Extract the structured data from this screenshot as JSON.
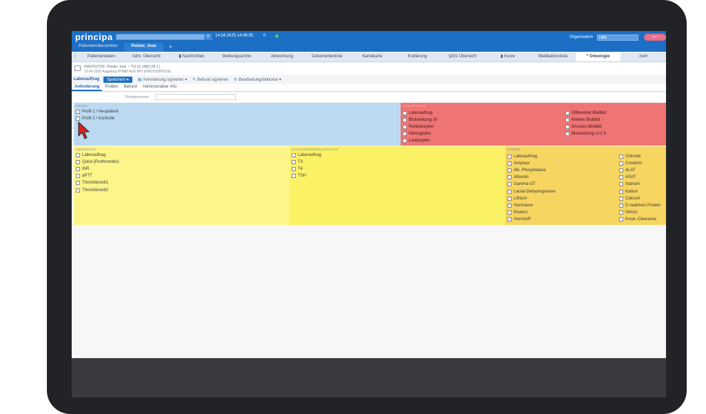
{
  "header": {
    "logo": "principa",
    "datetime": "14.04.2025 14:49:35",
    "count": "0",
    "org_label": "Organisation",
    "org_value": "HBK",
    "user_badge": "••• •",
    "tabs": [
      {
        "label": "Patientenübersichten"
      },
      {
        "label": "Peisler, Jose"
      },
      {
        "label": "+"
      }
    ]
  },
  "nav": {
    "tabs": [
      {
        "label": "Patientendaten"
      },
      {
        "label": "Adm. Übersicht"
      },
      {
        "label": "▮ Nachrichten"
      },
      {
        "label": "Meldungsarchiv"
      },
      {
        "label": "Abrechnung"
      },
      {
        "label": "Dokumentenliste"
      },
      {
        "label": "Karteikarte"
      },
      {
        "label": "Kodierung"
      },
      {
        "label": "§301 Übersicht"
      },
      {
        "label": "▮ Kurve"
      },
      {
        "label": "Medikationsliste"
      },
      {
        "label": "* Onkologie"
      },
      {
        "label": "meh"
      }
    ]
  },
  "patient": {
    "name": "KMVZ017311: Peisler, Jose ♂ *01.01.1989 (36 J.)",
    "sub": "10.04.2025 Augsburg KHMB AUG BHI (KMVZ0250012E)"
  },
  "toolbar": {
    "label": "Laborauftrag",
    "save": "Speichern ▾",
    "sign_request": "Anforderung signieren ▾",
    "sign_result": "Befund signieren",
    "status": "Bearbeitungsfaktoren ▾"
  },
  "subtabs": [
    "Anforderung",
    "Proben",
    "Befund",
    "Administrative Info"
  ],
  "belegnummer_label": "Belegnummer",
  "panels": {
    "profil": {
      "title": "Profil",
      "items": [
        "Profil 1 / Neupatient",
        "Profil 2 / Kontrolle"
      ]
    },
    "haematologie": {
      "title": "Hämatologie",
      "col1": [
        "Laborauftrag",
        "Blutsenkung 1h",
        "Retikulozyten",
        "Hämoglobin",
        "Leukozyten"
      ],
      "col2": [
        "Differential Blutbild",
        "Kleines Blutbild",
        "Grosses Blutbild",
        "Blutsenkung 1+2 h"
      ]
    },
    "gerinnung": {
      "title": "Gerinnung",
      "items": [
        "Laborauftrag",
        "Quick (Prothrombin)",
        "INR",
        "aPTT",
        "Thrombinzeit1",
        "Thrombinzeit2"
      ]
    },
    "schilddruese": {
      "title": "Schilddrüsendiagnostik",
      "items": [
        "Laborauftrag",
        "T3",
        "T4",
        "TSH"
      ]
    },
    "chemie": {
      "title": "Chemie",
      "col1": [
        "Laborauftrag",
        "Amylase",
        "Alk. Phosphatase",
        "Albumin",
        "Gamma-GT",
        "Lactat-Dehydrogenase",
        "Lithium",
        "Harnsäure",
        "Eiweiss",
        "Harnstoff"
      ],
      "col2": [
        "Chloride",
        "Creatinin",
        "ALAT",
        "ASAT",
        "Natrium",
        "Kalium",
        "Calcium",
        "C-reaktives Protein",
        "HbA1c",
        "Kreat.-Clearance"
      ]
    }
  },
  "colors": {
    "brand_blue": "#1c6fc4",
    "profil": "#bcd9f2",
    "haematologie": "#ef7474",
    "gerinnung": "#fbf58a",
    "schilddruese": "#fbf165",
    "chemie": "#f7d561"
  }
}
